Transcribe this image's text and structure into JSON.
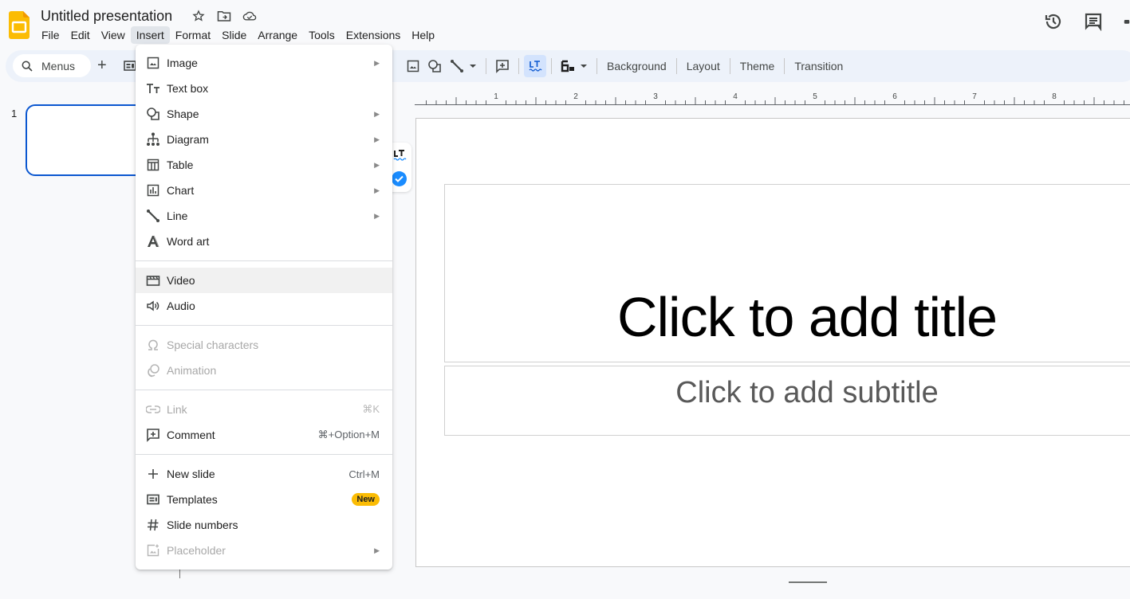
{
  "header": {
    "doc_title": "Untitled presentation",
    "menu": [
      "File",
      "Edit",
      "View",
      "Insert",
      "Format",
      "Slide",
      "Arrange",
      "Tools",
      "Extensions",
      "Help"
    ],
    "active_menu": "Insert"
  },
  "toolbar": {
    "search_label": "Menus",
    "buttons": [
      "Background",
      "Layout",
      "Theme",
      "Transition"
    ]
  },
  "ruler": {
    "labels": [
      "1",
      "2",
      "3",
      "4",
      "5",
      "6",
      "7",
      "8"
    ]
  },
  "slides_panel": {
    "slide_number": "1"
  },
  "slide": {
    "title_placeholder": "Click to add title",
    "subtitle_placeholder": "Click to add subtitle"
  },
  "insert_menu": {
    "groups": [
      [
        {
          "label": "Image",
          "icon": "image-icon",
          "submenu": true
        },
        {
          "label": "Text box",
          "icon": "text-box-icon"
        },
        {
          "label": "Shape",
          "icon": "shape-icon",
          "submenu": true
        },
        {
          "label": "Diagram",
          "icon": "diagram-icon",
          "submenu": true
        },
        {
          "label": "Table",
          "icon": "table-icon",
          "submenu": true
        },
        {
          "label": "Chart",
          "icon": "chart-icon",
          "submenu": true
        },
        {
          "label": "Line",
          "icon": "line-icon",
          "submenu": true
        },
        {
          "label": "Word art",
          "icon": "word-art-icon"
        }
      ],
      [
        {
          "label": "Video",
          "icon": "video-icon",
          "highlighted": true
        },
        {
          "label": "Audio",
          "icon": "audio-icon"
        }
      ],
      [
        {
          "label": "Special characters",
          "icon": "omega-icon",
          "disabled": true
        },
        {
          "label": "Animation",
          "icon": "animation-icon",
          "disabled": true
        }
      ],
      [
        {
          "label": "Link",
          "icon": "link-icon",
          "disabled": true,
          "shortcut": "⌘K"
        },
        {
          "label": "Comment",
          "icon": "comment-icon",
          "shortcut": "⌘+Option+M"
        }
      ],
      [
        {
          "label": "New slide",
          "icon": "plus-icon",
          "shortcut": "Ctrl+M"
        },
        {
          "label": "Templates",
          "icon": "templates-icon",
          "badge": "New"
        },
        {
          "label": "Slide numbers",
          "icon": "hash-icon"
        },
        {
          "label": "Placeholder",
          "icon": "placeholder-icon",
          "disabled": true,
          "submenu": true
        }
      ]
    ]
  },
  "colors": {
    "accent": "#0b57d0",
    "badge": "#fbbc04",
    "toolbar_bg": "#edf2fa",
    "active_toggle": "#d3e3fd"
  }
}
